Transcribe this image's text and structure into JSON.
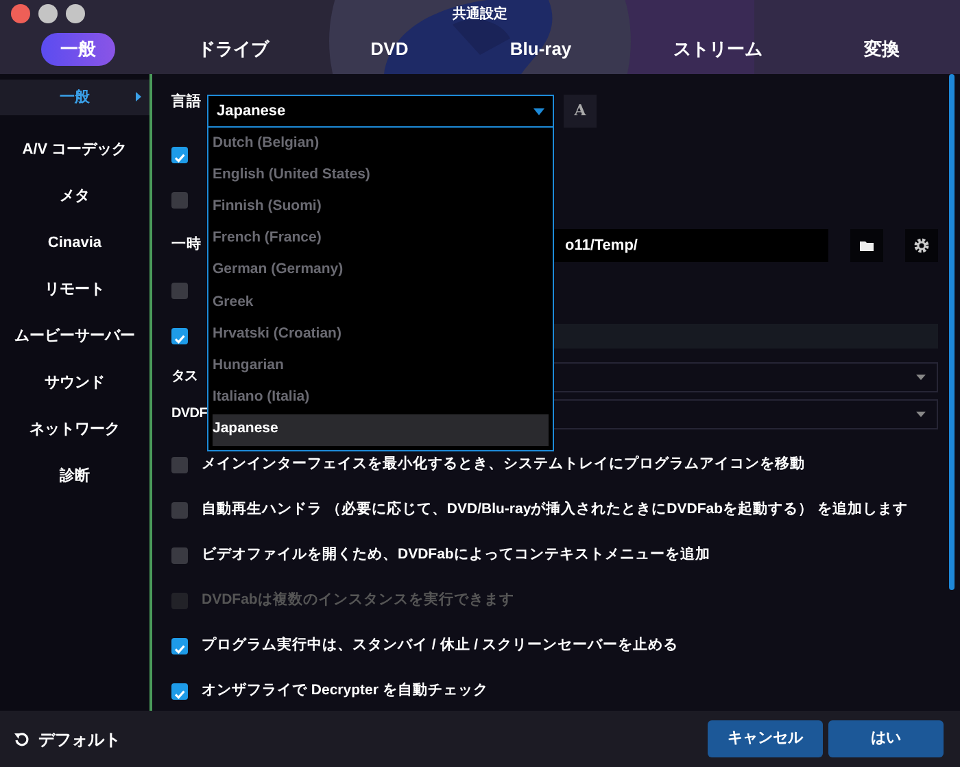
{
  "window": {
    "title": "共通設定",
    "buttons": [
      {
        "color": "#ee5f57"
      },
      {
        "color": "#c4c4c4"
      },
      {
        "color": "#c4c4c4"
      }
    ]
  },
  "tabs": [
    {
      "label": "一般",
      "selected": true
    },
    {
      "label": "ドライブ",
      "selected": false
    },
    {
      "label": "DVD",
      "selected": false
    },
    {
      "label": "Blu-ray",
      "selected": false
    },
    {
      "label": "ストリーム",
      "selected": false
    },
    {
      "label": "変換",
      "selected": false
    }
  ],
  "sidebar": {
    "items": [
      {
        "label": "一般",
        "selected": true
      },
      {
        "label": "A/V コーデック",
        "selected": false
      },
      {
        "label": "メタ",
        "selected": false
      },
      {
        "label": "Cinavia",
        "selected": false
      },
      {
        "label": "リモート",
        "selected": false
      },
      {
        "label": "ムービーサーバー",
        "selected": false
      },
      {
        "label": "サウンド",
        "selected": false
      },
      {
        "label": "ネットワーク",
        "selected": false
      },
      {
        "label": "診断",
        "selected": false
      }
    ]
  },
  "language": {
    "label": "言語",
    "value": "Japanese",
    "expanded": true,
    "font_button": "A",
    "options": [
      {
        "label": "Dutch (Belgian)",
        "selected": false
      },
      {
        "label": "English (United States)",
        "selected": false
      },
      {
        "label": "Finnish (Suomi)",
        "selected": false
      },
      {
        "label": "French (France)",
        "selected": false
      },
      {
        "label": "German (Germany)",
        "selected": false
      },
      {
        "label": "Greek",
        "selected": false
      },
      {
        "label": "Hrvatski (Croatian)",
        "selected": false
      },
      {
        "label": "Hungarian",
        "selected": false
      },
      {
        "label": "Italiano (Italia)",
        "selected": false
      },
      {
        "label": "Japanese",
        "selected": true
      }
    ]
  },
  "settings": [
    {
      "kind": "checkbox",
      "checked": true,
      "disabled": false
    },
    {
      "kind": "checkbox",
      "checked": false,
      "disabled": false
    },
    {
      "kind": "path",
      "label": "一時",
      "value": "o11/Temp/"
    },
    {
      "kind": "checkbox",
      "checked": false,
      "disabled": false
    },
    {
      "kind": "checkbox",
      "checked": true,
      "disabled": false,
      "highlighted": true
    },
    {
      "kind": "select",
      "label": "タス"
    },
    {
      "kind": "select",
      "label": "DVDF"
    },
    {
      "kind": "checkbox",
      "label": "メインインターフェイスを最小化するとき、システムトレイにプログラムアイコンを移動",
      "checked": false,
      "disabled": false
    },
    {
      "kind": "checkbox",
      "label": "自動再生ハンドラ （必要に応じて、DVD/Blu-rayが挿入されたときにDVDFabを起動する） を追加します",
      "checked": false,
      "disabled": false
    },
    {
      "kind": "checkbox",
      "label": "ビデオファイルを開くため、DVDFabによってコンテキストメニューを追加",
      "checked": false,
      "disabled": false
    },
    {
      "kind": "checkbox",
      "label": "DVDFabは複数のインスタンスを実行できます",
      "checked": false,
      "disabled": true
    },
    {
      "kind": "checkbox",
      "label": "プログラム実行中は、スタンバイ / 休止 / スクリーンセーバーを止める",
      "checked": true,
      "disabled": false
    },
    {
      "kind": "checkbox",
      "label": "オンザフライで Decrypter を自動チェック",
      "checked": true,
      "disabled": false
    }
  ],
  "footer": {
    "default_button": "デフォルト",
    "buttons": [
      "キャンセル",
      "はい"
    ]
  }
}
